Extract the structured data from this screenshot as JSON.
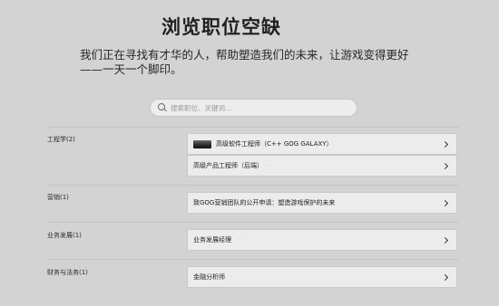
{
  "header": {
    "title": "浏览职位空缺",
    "subtitle": "我们正在寻找有才华的人，帮助塑造我们的未来，让游戏变得更好——一天一个脚印。"
  },
  "search": {
    "placeholder": "搜索职位、关键词..."
  },
  "departments": [
    {
      "name": "工程学(2)",
      "extra": "·",
      "jobs": [
        {
          "title": "高级软件工程师（C++ GOG GALAXY）",
          "extra": "",
          "icon": "galaxy-thumbnail-icon"
        },
        {
          "title": "高级产品工程师（后端）",
          "extra": "· ·"
        }
      ]
    },
    {
      "name": "营销(1)",
      "extra": "·",
      "jobs": [
        {
          "title": "致GOG营销团队的公开申请：塑造游戏保护的未来",
          "extra": ""
        }
      ]
    },
    {
      "name": "业务发展(1)",
      "extra": "· ·",
      "jobs": [
        {
          "title": "业务发展经理",
          "extra": "· ·"
        }
      ]
    },
    {
      "name": "财务与法务(1)",
      "extra": "·",
      "jobs": [
        {
          "title": "金融分析师",
          "extra": "·"
        }
      ]
    }
  ],
  "icons": {
    "chevron": "chevron-right-icon",
    "search": "search-icon"
  },
  "colors": {
    "background": "#d3d3d3",
    "row": "#ececec"
  }
}
